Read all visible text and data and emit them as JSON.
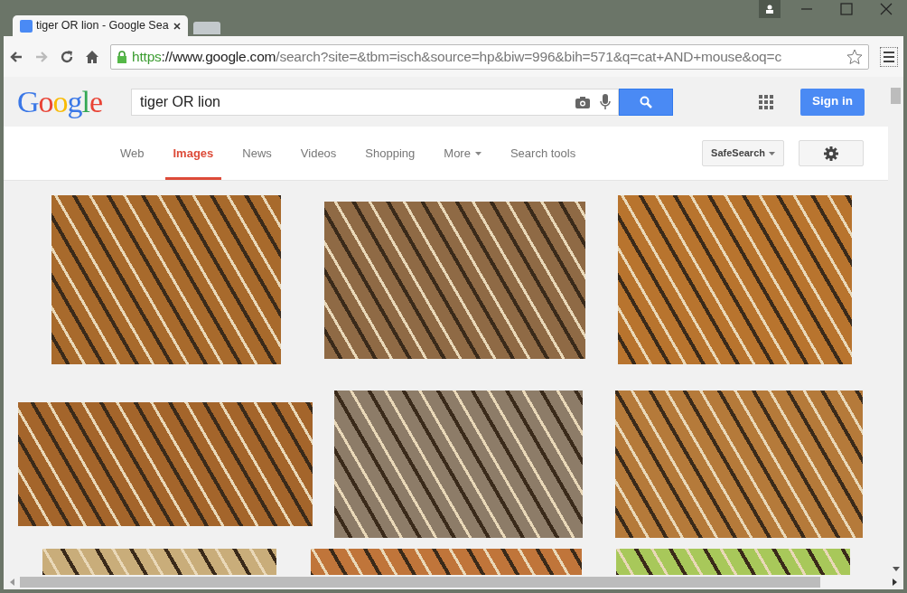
{
  "browser_tab": {
    "title": "tiger OR lion - Google Sea"
  },
  "address_bar": {
    "scheme": "https",
    "host": "://www.google.com",
    "path": "/search?site=&tbm=isch&source=hp&biw=996&bih=571&q=cat+AND+mouse&oq=c"
  },
  "logo": {
    "text": "Google"
  },
  "search": {
    "query": "tiger OR lion",
    "sign_in": "Sign in"
  },
  "nav_tabs": [
    {
      "label": "Web",
      "selected": false
    },
    {
      "label": "Images",
      "selected": true
    },
    {
      "label": "News",
      "selected": false
    },
    {
      "label": "Videos",
      "selected": false
    },
    {
      "label": "Shopping",
      "selected": false
    },
    {
      "label": "More",
      "selected": false,
      "kind": "menu"
    },
    {
      "label": "Search tools",
      "selected": false
    }
  ],
  "safesearch": {
    "label": "SafeSearch"
  }
}
